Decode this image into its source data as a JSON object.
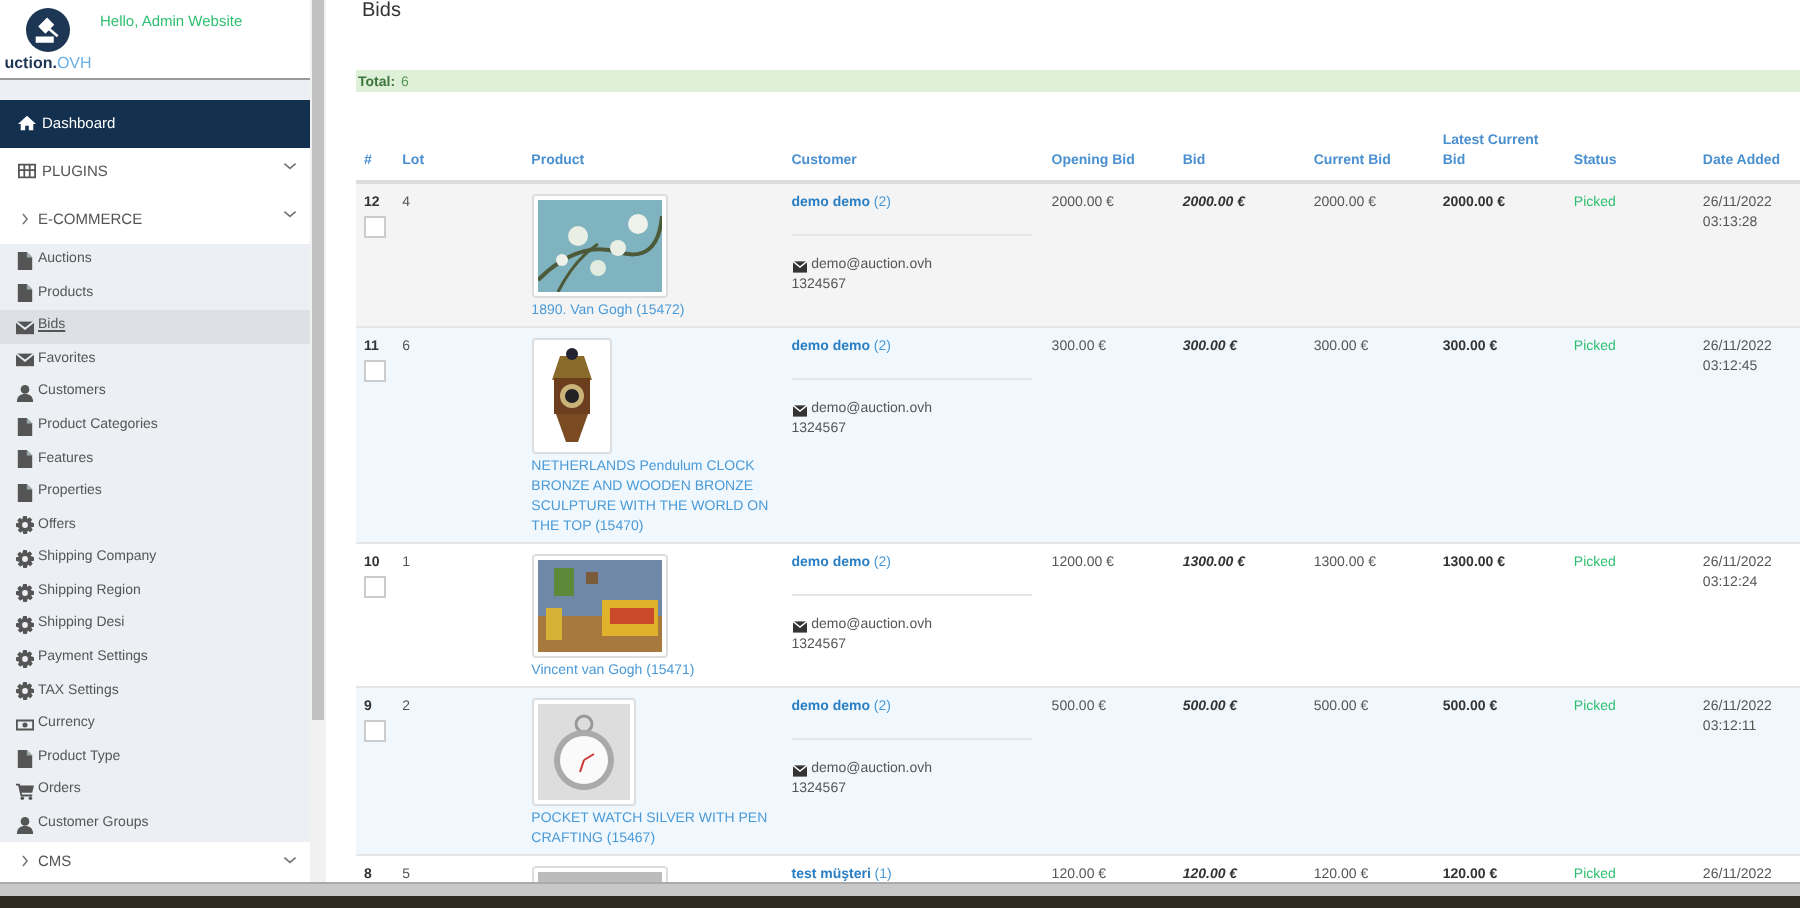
{
  "sidebar": {
    "greeting": "Hello, Admin Website",
    "logo": {
      "text": "uction.",
      "suffix": "OVH"
    },
    "items": [
      {
        "label": "Dashboard",
        "kind": "home",
        "selected": true
      },
      {
        "label": "PLUGINS",
        "kind": "grid",
        "selected": false
      },
      {
        "label": "E-COMMERCE",
        "kind": "group",
        "selected": false,
        "children": [
          {
            "label": "Auctions",
            "kind": "page",
            "selected": false
          },
          {
            "label": "Products",
            "kind": "page",
            "selected": false
          },
          {
            "label": "Bids",
            "kind": "mail",
            "selected": true
          },
          {
            "label": "Favorites",
            "kind": "mail",
            "selected": false
          },
          {
            "label": "Customers",
            "kind": "user",
            "selected": false
          },
          {
            "label": "Product Categories",
            "kind": "page",
            "selected": false
          },
          {
            "label": "Features",
            "kind": "page",
            "selected": false
          },
          {
            "label": "Properties",
            "kind": "page",
            "selected": false
          },
          {
            "label": "Offers",
            "kind": "gear",
            "selected": false
          },
          {
            "label": "Shipping Company",
            "kind": "gear",
            "selected": false
          },
          {
            "label": "Shipping Region",
            "kind": "gear",
            "selected": false
          },
          {
            "label": "Shipping Desi",
            "kind": "gear",
            "selected": false
          },
          {
            "label": "Payment Settings",
            "kind": "gear",
            "selected": false
          },
          {
            "label": "TAX Settings",
            "kind": "gear",
            "selected": false
          },
          {
            "label": "Currency",
            "kind": "money",
            "selected": false
          },
          {
            "label": "Product Type",
            "kind": "page",
            "selected": false
          },
          {
            "label": "Orders",
            "kind": "cart",
            "selected": false
          },
          {
            "label": "Customer Groups",
            "kind": "user",
            "selected": false
          }
        ]
      },
      {
        "label": "CMS",
        "kind": "group",
        "selected": false
      }
    ]
  },
  "page": {
    "title": "Bids",
    "total": {
      "label": "Total:",
      "value": "6"
    }
  },
  "table": {
    "columns": [
      "#",
      "Lot",
      "Product",
      "Customer",
      "Opening Bid",
      "Bid",
      "Current Bid",
      "Latest Current Bid",
      "Status",
      "Date Added"
    ],
    "rows": [
      {
        "number": "12",
        "checked": false,
        "color": "#f4f4f4",
        "lot": "4",
        "product": "1890. Van Gogh",
        "product_id": "(15472)",
        "customer": "demo demo",
        "customer_count": "(2)",
        "email": "demo@auction.ovh",
        "phone": "1324567",
        "opening_bid": "2000.00 €",
        "bid": "2000.00 €",
        "current_bid": "2000.00 €",
        "latest_current_bid": "2000.00 €",
        "status": "Picked",
        "date": "26/11/2022",
        "time": "03:13:28"
      },
      {
        "number": "11",
        "checked": false,
        "color": "#f1f8fd",
        "lot": "6",
        "product": "NETHERLANDS Pendulum CLOCK BRONZE AND WOODEN BRONZE SCULPTURE WITH THE WORLD ON THE TOP",
        "product_id": "(15470)",
        "customer": "demo demo",
        "customer_count": "(2)",
        "email": "demo@auction.ovh",
        "phone": "1324567",
        "opening_bid": "300.00 €",
        "bid": "300.00 €",
        "current_bid": "300.00 €",
        "latest_current_bid": "300.00 €",
        "status": "Picked",
        "date": "26/11/2022",
        "time": "03:12:45"
      },
      {
        "number": "10",
        "checked": false,
        "color": "#ffffff",
        "lot": "1",
        "product": "Vincent van Gogh",
        "product_id": "(15471)",
        "customer": "demo demo",
        "customer_count": "(2)",
        "email": "demo@auction.ovh",
        "phone": "1324567",
        "opening_bid": "1200.00 €",
        "bid": "1300.00 €",
        "current_bid": "1300.00 €",
        "latest_current_bid": "1300.00 €",
        "status": "Picked",
        "date": "26/11/2022",
        "time": "03:12:24"
      },
      {
        "number": "9",
        "checked": false,
        "color": "#f1f8fd",
        "lot": "2",
        "product": "POCKET WATCH SILVER WITH PEN CRAFTING",
        "product_id": "(15467)",
        "customer": "demo demo",
        "customer_count": "(2)",
        "email": "demo@auction.ovh",
        "phone": "1324567",
        "opening_bid": "500.00 €",
        "bid": "500.00 €",
        "current_bid": "500.00 €",
        "latest_current_bid": "500.00 €",
        "status": "Picked",
        "date": "26/11/2022",
        "time": "03:12:11"
      },
      {
        "number": "8",
        "color": "#ffffff",
        "lot": "5",
        "customer": "test müşteri",
        "customer_count": "(1)",
        "opening_bid": "120.00 €",
        "bid": "120.00 €",
        "current_bid": "120.00 €",
        "latest_current_bid": "120.00 €",
        "status": "Picked",
        "date": "26/11/2022"
      }
    ]
  }
}
